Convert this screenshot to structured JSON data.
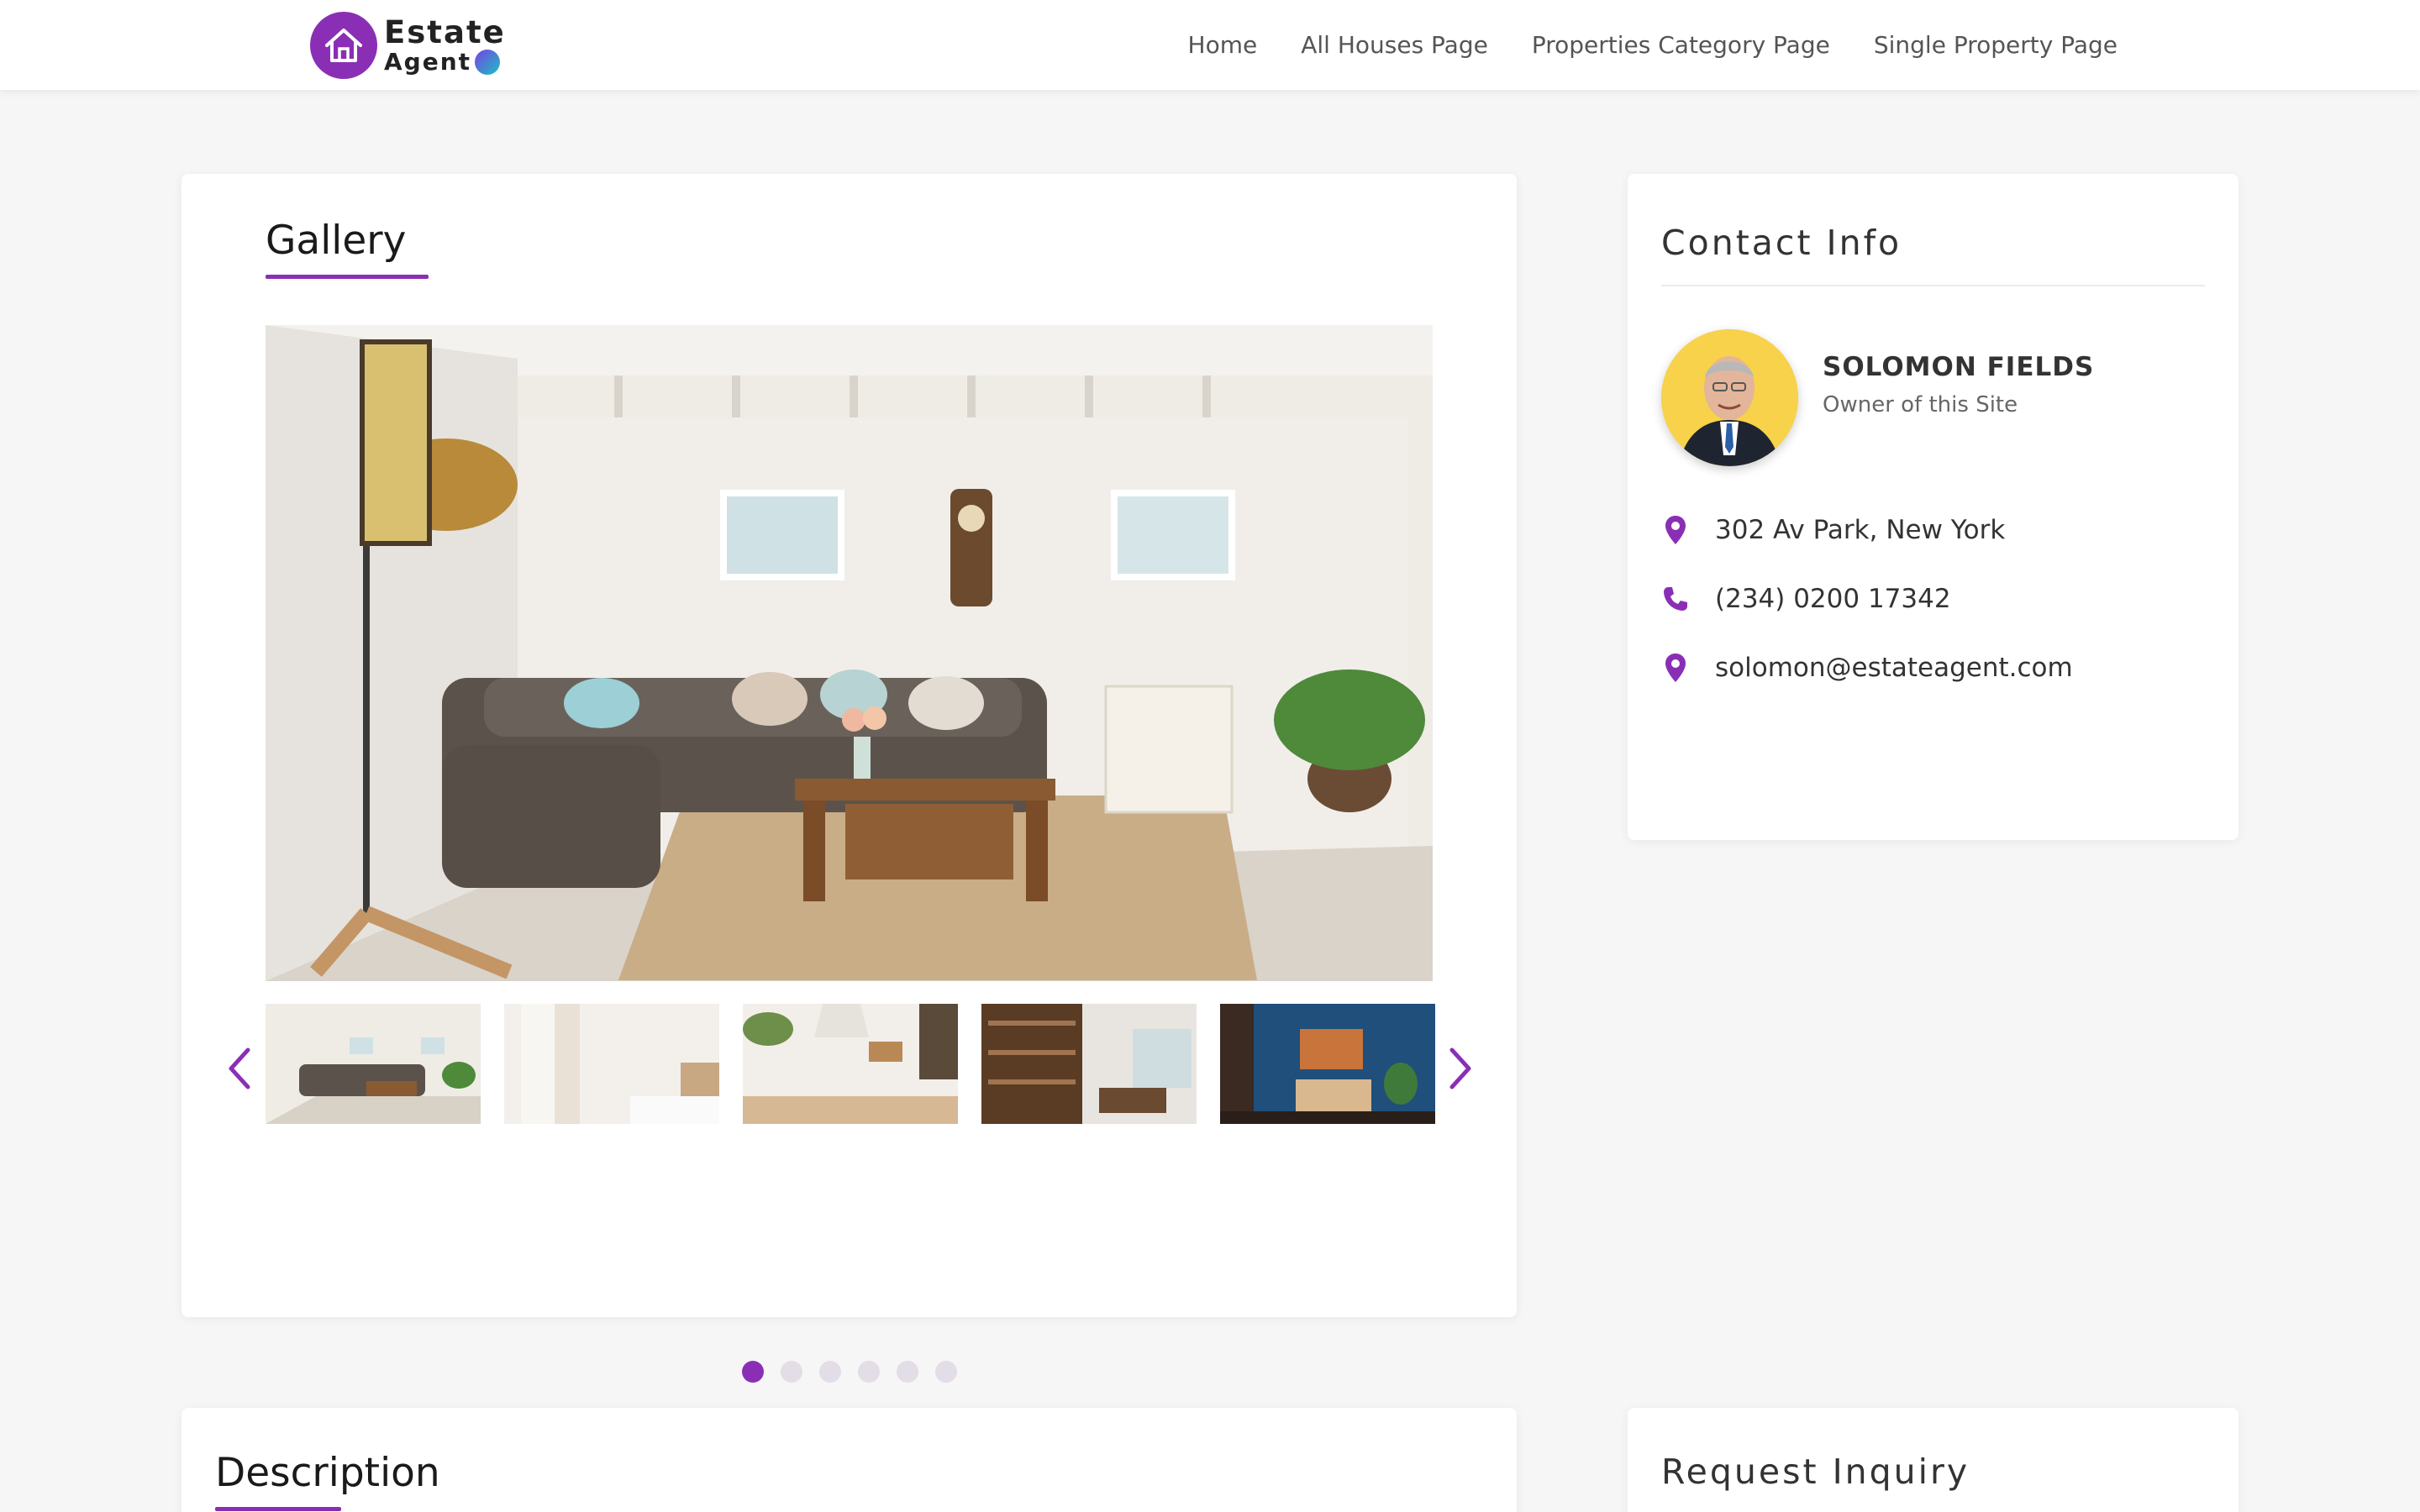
{
  "brand": {
    "line1": "Estate",
    "line2": "Agent",
    "accent": "#8a2fb5"
  },
  "nav": [
    {
      "label": "Home"
    },
    {
      "label": "All Houses Page"
    },
    {
      "label": "Properties Category Page"
    },
    {
      "label": "Single Property Page"
    }
  ],
  "gallery": {
    "title": "Gallery",
    "thumbnails": [
      "living-room",
      "bedroom",
      "kitchen",
      "study",
      "blue-room"
    ],
    "dots_total": 6,
    "active_dot": 1
  },
  "contact": {
    "title": "Contact Info",
    "agent_name": "SOLOMON FIELDS",
    "agent_role": "Owner of this Site",
    "address": "302 Av Park, New York",
    "phone": "(234) 0200 17342",
    "email": "solomon@estateagent.com",
    "icons": {
      "address": "location-pin-icon",
      "phone": "phone-icon",
      "email": "location-pin-icon"
    }
  },
  "description": {
    "title": "Description"
  },
  "inquiry": {
    "title": "Request Inquiry"
  }
}
